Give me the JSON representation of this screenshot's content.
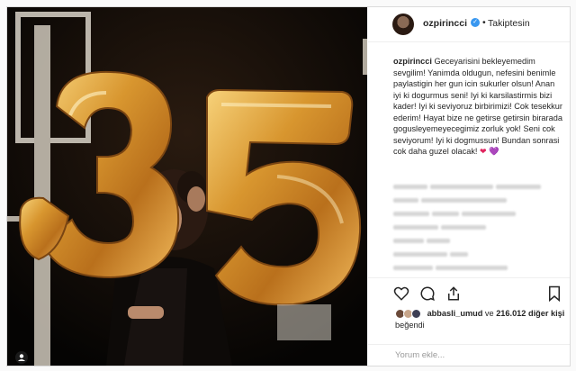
{
  "header": {
    "username": "ozpirincci",
    "verified_icon": "verified-badge-icon",
    "separator": "•",
    "follow_status": "Takiptesin"
  },
  "caption": {
    "author": "ozpirincci",
    "text": "Geceyarisini bekleyemedim sevgilim! Yanimda oldugun, nefesini benimle paylastigin her gun icin sukurler olsun! Anan iyi ki dogurmus seni! Iyi ki karsilastirmis bizi kader! Iyi ki seviyoruz birbirimizi! Cok tesekkur ederim! Hayat bize ne getirse getirsin birarada gogusleyemeyecegimiz zorluk yok! Seni cok seviyorum! Iyi ki dogmussun! Bundan sonrasi cok daha guzel olacak!",
    "emoji_1": "❤",
    "emoji_2": "💜"
  },
  "photo": {
    "balloon_digits": [
      "3",
      "5"
    ],
    "balloon_color": "#c8893a"
  },
  "actions": {
    "icons": [
      "heart-icon",
      "comment-icon",
      "share-icon",
      "bookmark-icon"
    ]
  },
  "likes": {
    "user": "abbasli_umud",
    "connector": "ve",
    "count": "216.012",
    "suffix": "diğer kişi",
    "verb": "beğendi"
  },
  "comment_input": {
    "placeholder": "Yorum ekle..."
  },
  "colors": {
    "link_blue": "#3897f0",
    "text": "#262626",
    "border": "#dbdbdb"
  }
}
